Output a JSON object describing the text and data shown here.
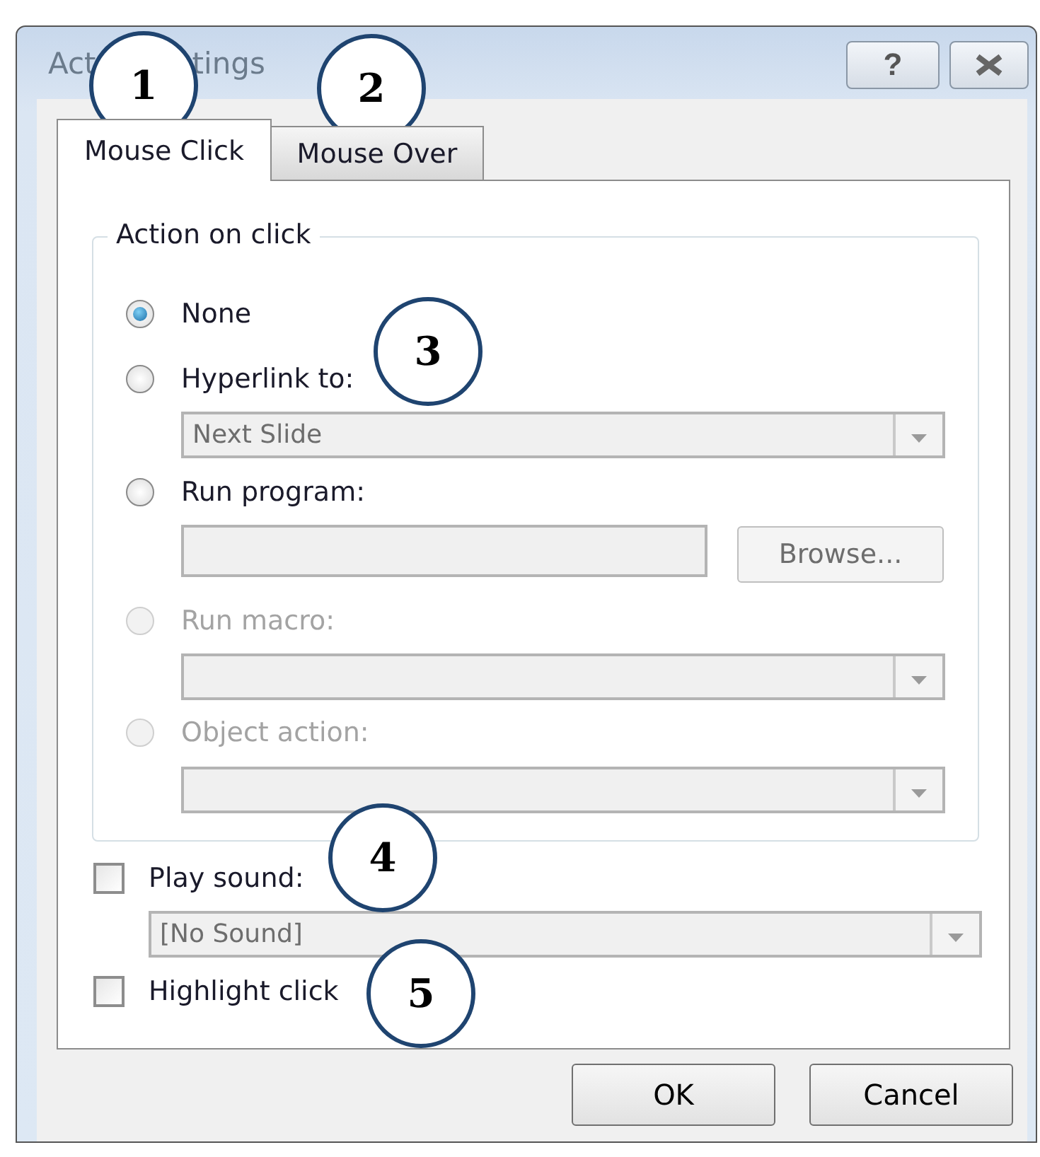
{
  "window": {
    "title_start": "Act",
    "title_end": "tings"
  },
  "title_buttons": [
    {
      "kind": "help",
      "label": "?"
    },
    {
      "kind": "close"
    }
  ],
  "tabs": [
    {
      "label": "Mouse Click",
      "selected": true
    },
    {
      "label": "Mouse Over",
      "selected": false
    }
  ],
  "action_group": {
    "legend": "Action on click",
    "options": [
      {
        "label": "None",
        "selected": true,
        "disabled": false
      },
      {
        "label": "Hyperlink to:",
        "selected": false,
        "disabled": false,
        "control": {
          "kind": "combo",
          "value": "Next Slide",
          "disabled": true
        }
      },
      {
        "label": "Run program:",
        "selected": false,
        "disabled": false,
        "control": {
          "kind": "field",
          "disabled": true,
          "button": {
            "label": "Browse...",
            "disabled": true
          }
        }
      },
      {
        "label": "Run macro:",
        "selected": false,
        "disabled": true,
        "control": {
          "kind": "combo",
          "disabled": true
        }
      },
      {
        "label": "Object action:",
        "selected": false,
        "disabled": true,
        "control": {
          "kind": "combo",
          "disabled": true
        }
      }
    ]
  },
  "play_sound": {
    "label": "Play sound:",
    "checked": false
  },
  "sound_combo": {
    "value": "[No Sound]",
    "disabled": true
  },
  "highlight_click": {
    "label": "Highlight click",
    "checked": false
  },
  "buttons": [
    "OK",
    "Cancel"
  ],
  "callouts": [
    "1",
    "2",
    "3",
    "4",
    "5"
  ]
}
